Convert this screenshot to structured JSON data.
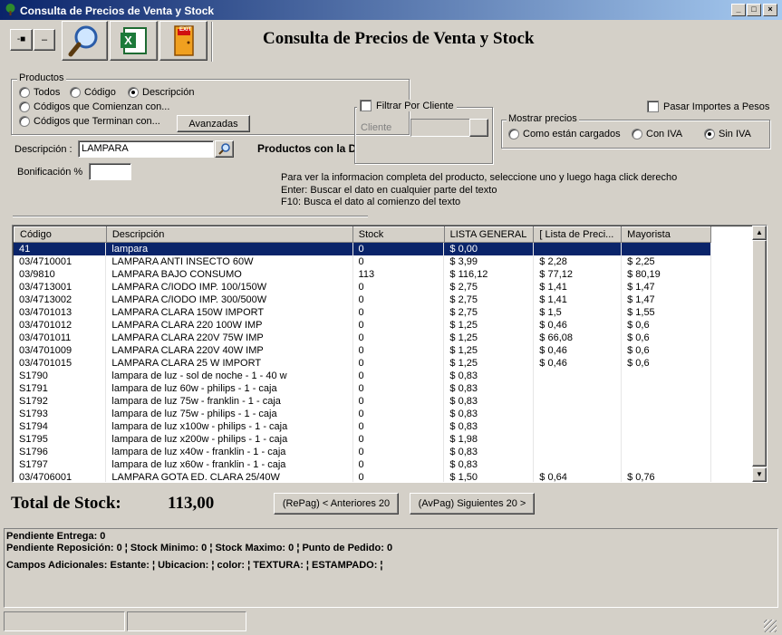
{
  "window": {
    "title": "Consulta de Precios de Venta y Stock"
  },
  "toolbar": {
    "pin_label": "-■",
    "minus_label": "–",
    "exit_label": "EXIT"
  },
  "header": {
    "title": "Consulta de Precios de Venta y Stock"
  },
  "productos": {
    "legend": "Productos",
    "todos": "Todos",
    "codigo": "Código",
    "descripcion": "Descripción",
    "comienzan": "Códigos que Comienzan con...",
    "terminan": "Códigos que Terminan con...",
    "avanzadas": "Avanzadas"
  },
  "filtro": {
    "label": "Filtrar Por Cliente",
    "cliente_label": "Cliente",
    "cliente_value": ""
  },
  "pasar_importes": "Pasar Importes a Pesos",
  "mostrar": {
    "legend": "Mostrar precios",
    "cargados": "Como están cargados",
    "con_iva": "Con IVA",
    "sin_iva": "Sin IVA"
  },
  "descripcion": {
    "label": "Descripción :",
    "value": "LAMPARA"
  },
  "productos_con": "Productos con la D",
  "bonificacion": {
    "label": "Bonificación %",
    "value": ""
  },
  "help": {
    "line1": "Para ver la informacion completa del producto, seleccione uno y luego haga click derecho",
    "line2": "Enter: Buscar el dato en cualquier parte del texto",
    "line3": "F10: Busca el dato al comienzo del texto"
  },
  "table": {
    "headers": [
      "Código",
      "Descripción",
      "Stock",
      "LISTA GENERAL",
      "[ Lista de Preci...",
      "Mayorista"
    ],
    "rows": [
      [
        "41",
        "lampara",
        "0",
        "$ 0,00",
        "",
        ""
      ],
      [
        "03/4710001",
        "LAMPARA ANTI INSECTO 60W",
        "0",
        "$ 3,99",
        "$ 2,28",
        "$ 2,25"
      ],
      [
        "03/9810",
        "LAMPARA BAJO CONSUMO",
        "113",
        "$ 116,12",
        "$ 77,12",
        "$ 80,19"
      ],
      [
        "03/4713001",
        "LAMPARA C/IODO IMP. 100/150W",
        "0",
        "$ 2,75",
        "$ 1,41",
        "$ 1,47"
      ],
      [
        "03/4713002",
        "LAMPARA C/IODO IMP. 300/500W",
        "0",
        "$ 2,75",
        "$ 1,41",
        "$ 1,47"
      ],
      [
        "03/4701013",
        "LAMPARA CLARA 150W IMPORT",
        "0",
        "$ 2,75",
        "$ 1,5",
        "$ 1,55"
      ],
      [
        "03/4701012",
        "LAMPARA CLARA 220 100W IMP",
        "0",
        "$ 1,25",
        "$ 0,46",
        "$ 0,6"
      ],
      [
        "03/4701011",
        "LAMPARA CLARA 220V  75W IMP",
        "0",
        "$ 1,25",
        "$ 66,08",
        "$ 0,6"
      ],
      [
        "03/4701009",
        "LAMPARA CLARA 220V 40W IMP",
        "0",
        "$ 1,25",
        "$ 0,46",
        "$ 0,6"
      ],
      [
        "03/4701015",
        "LAMPARA CLARA 25 W IMPORT",
        "0",
        "$ 1,25",
        "$ 0,46",
        "$ 0,6"
      ],
      [
        "S1790",
        "lampara de luz - sol de noche - 1 - 40 w",
        "0",
        "$ 0,83",
        "",
        ""
      ],
      [
        "S1791",
        "lampara de luz 60w - philips - 1 - caja",
        "0",
        "$ 0,83",
        "",
        ""
      ],
      [
        "S1792",
        "lampara de luz 75w - franklin - 1 - caja",
        "0",
        "$ 0,83",
        "",
        ""
      ],
      [
        "S1793",
        "lampara de luz 75w - philips - 1 - caja",
        "0",
        "$ 0,83",
        "",
        ""
      ],
      [
        "S1794",
        "lampara de luz x100w - philips - 1 - caja",
        "0",
        "$ 0,83",
        "",
        ""
      ],
      [
        "S1795",
        "lampara de luz x200w - philips - 1 - caja",
        "0",
        "$ 1,98",
        "",
        ""
      ],
      [
        "S1796",
        "lampara de luz x40w - franklin - 1 - caja",
        "0",
        "$ 0,83",
        "",
        ""
      ],
      [
        "S1797",
        "lampara de luz x60w - franklin - 1 - caja",
        "0",
        "$ 0,83",
        "",
        ""
      ],
      [
        "03/4706001",
        "LAMPARA GOTA ED. CLARA 25/40W",
        "0",
        "$ 1,50",
        "$ 0,64",
        "$ 0,76"
      ]
    ]
  },
  "total": {
    "label": "Total de Stock:",
    "value": "113,00"
  },
  "nav": {
    "prev": "(RePag) < Anteriores 20",
    "next": "(AvPag) Siguientes 20 >"
  },
  "info": {
    "line1": "Pendiente Entrega: 0",
    "line2": "Pendiente Reposición: 0 ¦ Stock Minimo: 0 ¦ Stock Maximo: 0 ¦ Punto de Pedido: 0",
    "line3": "Campos Adicionales: Estante: ¦ Ubicacion: ¦ color: ¦ TEXTURA: ¦ ESTAMPADO: ¦"
  },
  "colors": {
    "title_start": "#0a246a",
    "title_end": "#a6caf0",
    "selection": "#0a246a",
    "face": "#d4d0c8"
  },
  "icons": [
    "pin-icon",
    "search-icon",
    "excel-icon",
    "exit-icon"
  ]
}
